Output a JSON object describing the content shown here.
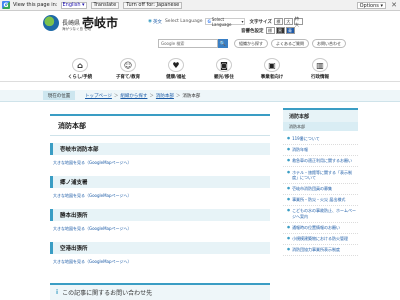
{
  "translate_bar": {
    "view_text": "View this page in:",
    "language": "English",
    "translate": "Translate",
    "turn_off": "Turn off for: Japanese",
    "options": "Options",
    "close": "✕"
  },
  "header": {
    "pref": "長崎県",
    "city": "壱岐市",
    "tagline": "海がつなぐ島 壱岐",
    "english_link": "英文",
    "language_link": "Select Language",
    "language_selector": "Select Language",
    "font_size_label": "文字サイズ",
    "font_size_buttons": [
      "標",
      "大",
      "特大"
    ],
    "voice_label": "音響色設定",
    "voice_buttons": [
      "標",
      "黒",
      "青"
    ],
    "search_placeholder": "Google 検索",
    "search_button": "🔍",
    "pills": [
      "組織から探す",
      "よくあるご質問",
      "お問い合わせ"
    ]
  },
  "nav": [
    {
      "label": "くらし/手続",
      "icon": "home-icon"
    },
    {
      "label": "子育て/教育",
      "icon": "child-icon"
    },
    {
      "label": "健康/福祉",
      "icon": "heart-icon"
    },
    {
      "label": "観光/移住",
      "icon": "camera-icon"
    },
    {
      "label": "事業者向け",
      "icon": "briefcase-icon"
    },
    {
      "label": "行政情報",
      "icon": "building-icon"
    }
  ],
  "breadcrumb": {
    "here_label": "現在の位置",
    "items": [
      "トップページ",
      "組織から探す",
      "消防本部"
    ],
    "current": "消防本部"
  },
  "main": {
    "title": "消防本部",
    "sections": [
      {
        "heading": "壱岐市消防本部",
        "link": "大きな地図を見る（GoogleMapページへ）"
      },
      {
        "heading": "郷ノ浦支署",
        "link": "大きな地図を見る（GoogleMapページへ）"
      },
      {
        "heading": "勝本出張所",
        "link": "大きな地図を見る（GoogleMapページへ）"
      },
      {
        "heading": "空港出張所",
        "link": "大きな地図を見る（GoogleMapページへ）"
      }
    ],
    "inquiry": "この記事に関するお問い合わせ先",
    "inquiry_icon": "i"
  },
  "sidebar": {
    "heading": "消防本部",
    "sub": "消防本部",
    "items": [
      "119番について",
      "消防年報",
      "救急車の適正利用に関するお願い",
      "ホテル・旅館等に関する「表示制度」について",
      "壱岐市消防団員の募集",
      "事業所・防災・火災 届出様式",
      "こどもの水の事故防止、ホームページへ案内",
      "通報時の位置情報のお願い",
      "小規模建築物における防火管理",
      "消防団協力事業所表示制度"
    ]
  }
}
